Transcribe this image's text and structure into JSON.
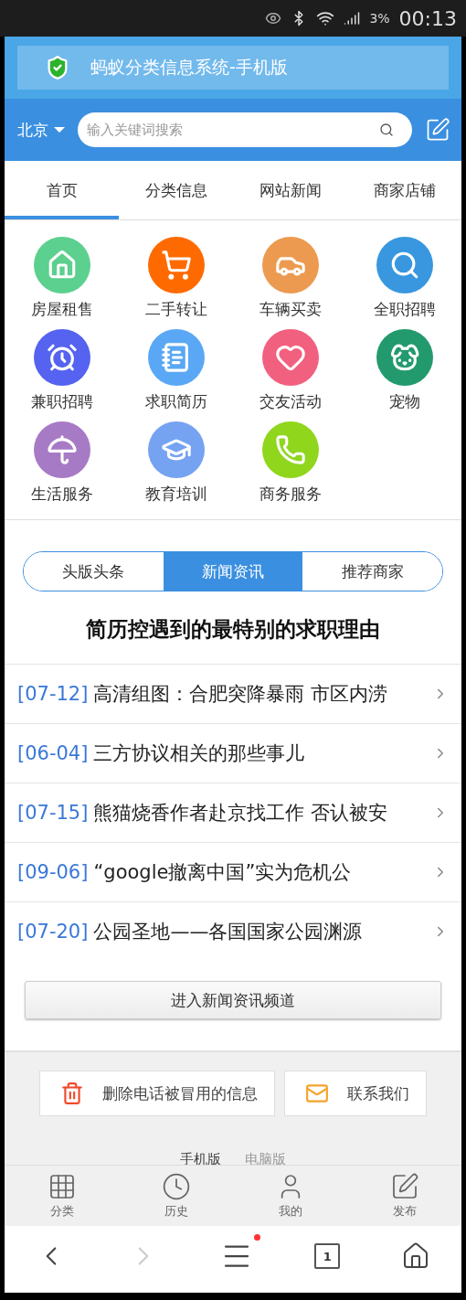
{
  "status_bar": {
    "battery": "3%",
    "time": "00:13"
  },
  "title_bar": {
    "title": "蚂蚁分类信息系统-手机版"
  },
  "header": {
    "city": "北京",
    "search": {
      "placeholder": "输入关键词搜索"
    }
  },
  "tabs": [
    {
      "label": "首页",
      "selected": true
    },
    {
      "label": "分类信息",
      "selected": false
    },
    {
      "label": "网站新闻",
      "selected": false
    },
    {
      "label": "商家店铺",
      "selected": false
    }
  ],
  "categories": [
    {
      "label": "房屋租售",
      "color": "#5cd08e"
    },
    {
      "label": "二手转让",
      "color": "#ff6a00"
    },
    {
      "label": "车辆买卖",
      "color": "#ec9a50"
    },
    {
      "label": "全职招聘",
      "color": "#3897de"
    },
    {
      "label": "兼职招聘",
      "color": "#5563f0"
    },
    {
      "label": "求职简历",
      "color": "#5aa8f5"
    },
    {
      "label": "交友活动",
      "color": "#f2607f"
    },
    {
      "label": "宠物",
      "color": "#239a6e"
    },
    {
      "label": "生活服务",
      "color": "#a77ac6"
    },
    {
      "label": "教育培训",
      "color": "#75a3f2"
    },
    {
      "label": "商务服务",
      "color": "#8fd61c"
    }
  ],
  "news_tabs": [
    {
      "label": "头版头条",
      "selected": false
    },
    {
      "label": "新闻资讯",
      "selected": true
    },
    {
      "label": "推荐商家",
      "selected": false
    }
  ],
  "headline": "简历控遇到的最特别的求职理由",
  "news": [
    {
      "date": "[07-12]",
      "title": "高清组图：合肥突降暴雨 市区内涝"
    },
    {
      "date": "[06-04]",
      "title": "三方协议相关的那些事儿"
    },
    {
      "date": "[07-15]",
      "title": "熊猫烧香作者赴京找工作 否认被安"
    },
    {
      "date": "[09-06]",
      "title": "“google撤离中国”实为危机公"
    },
    {
      "date": "[07-20]",
      "title": "公园圣地——各国国家公园渊源"
    }
  ],
  "more_button": "进入新闻资讯频道",
  "actions": [
    {
      "label": "删除电话被冒用的信息",
      "kind": "trash"
    },
    {
      "label": "联系我们",
      "kind": "mail"
    }
  ],
  "versions": [
    {
      "label": "手机版",
      "selected": true
    },
    {
      "label": "电脑版",
      "selected": false
    }
  ],
  "bottom_tabs": [
    {
      "label": "分类",
      "kind": "grid"
    },
    {
      "label": "历史",
      "kind": "clock"
    },
    {
      "label": "我的",
      "kind": "user"
    },
    {
      "label": "发布",
      "kind": "edit"
    }
  ],
  "browser_nav": {
    "tab_count": "1",
    "menu_badge": true,
    "forward_disabled": true
  }
}
